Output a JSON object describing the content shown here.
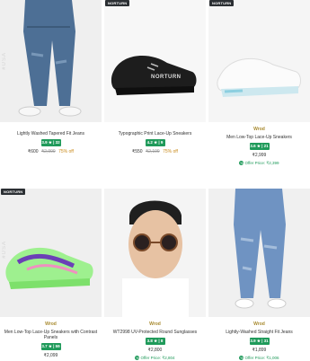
{
  "products": [
    {
      "badge": "",
      "brand": "",
      "name": "Lightly Washed Tapered Fit Jeans",
      "rating": "3.9 ★ | 32",
      "price": "₹600",
      "mrp": "₹2,999",
      "discount": "75% off",
      "offer": "",
      "watermark": "#USA"
    },
    {
      "badge": "NORTURN",
      "brand": "",
      "name": "Typographic Print Lace-Up Sneakers",
      "rating": "4.2 ★ | 9",
      "price": "₹550",
      "mrp": "₹2,199",
      "discount": "75% off",
      "offer": "",
      "shoe_text": "NORTURN"
    },
    {
      "badge": "NORTURN",
      "brand": "",
      "name": "Men Low-Top Lace-Up Sneakers",
      "rating": "3.6 ★ | 21",
      "price": "₹2,999",
      "mrp": "",
      "discount": "",
      "offer": "Offer Price: ₹2,399"
    },
    {
      "badge": "NORTURN",
      "brand": "Wrod",
      "name": "Men Low-Top Lace-Up Sneakers with Contrast Panels",
      "rating": "3.7 ★ | 59",
      "price": "₹2,099",
      "mrp": "",
      "discount": "",
      "offer": "",
      "watermark": "#USA"
    },
    {
      "badge": "",
      "brand": "Wrod",
      "name": "WT2998 UV-Protected Round Sunglasses",
      "rating": "3.8 ★ | 8",
      "price": "₹2,800",
      "mrp": "",
      "discount": "",
      "offer": "Offer Price: ₹2,804"
    },
    {
      "badge": "",
      "brand": "Wrod",
      "name": "Lightly-Washed Straight Fit Jeans",
      "rating": "3.9 ★ | 31",
      "price": "₹1,899",
      "mrp": "",
      "discount": "",
      "offer": "Offer Price: ₹1,006"
    }
  ],
  "top_brand": "Wrod",
  "colors": {
    "rating_bg": "#1f9a5a",
    "brand": "#a88a2f",
    "offer": "#1f9a5a"
  }
}
